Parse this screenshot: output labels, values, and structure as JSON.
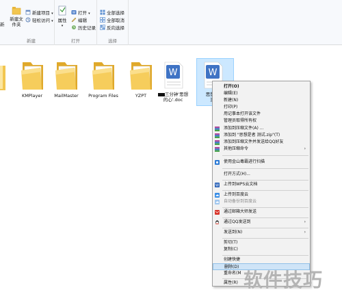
{
  "ribbon": {
    "new_group": {
      "label": "新建",
      "new_folder": "新建文件夹",
      "new_item": "新建项目",
      "easy_access": "轻松访问"
    },
    "open_group": {
      "label": "打开",
      "properties": "属性",
      "open": "打开",
      "edit": "编辑",
      "history": "历史记录"
    },
    "select_group": {
      "label": "选择",
      "select_all": "全部选择",
      "select_none": "全部取消",
      "invert": "反向选择"
    },
    "partial_left": "新"
  },
  "files": [
    {
      "name": "KMPlayer"
    },
    {
      "name": "MailMaster"
    },
    {
      "name": "Program Files"
    },
    {
      "name": "YZPT"
    },
    {
      "name_line1": "三分钟'思想",
      "name_line2": "的心'.doc"
    },
    {
      "name_line1": "思想是",
      "name_line2": "测"
    }
  ],
  "menu": {
    "items": [
      {
        "label": "打开(O)"
      },
      {
        "label": "编辑(E)"
      },
      {
        "label": "新建(N)"
      },
      {
        "label": "打印(P)"
      },
      {
        "label": "用记事本打开该文件"
      },
      {
        "label": "管理员取得所有权"
      },
      {
        "label": "添加到压缩文件(A) ..."
      },
      {
        "label": "添加到 \"思想是者 测试.zip\"(T)"
      },
      {
        "label": "添加到压缩文件并发送给QQ好友"
      },
      {
        "label": "其他压缩命令"
      },
      {
        "label": "使用金山毒霸进行扫描"
      },
      {
        "label": "打开方式(H)..."
      },
      {
        "label": "上传到WPS云文档"
      },
      {
        "label": "上传到百度云"
      },
      {
        "label": "自动备份到百度云"
      },
      {
        "label": "通过邮箱大师发送"
      },
      {
        "label": "通过QQ发送到"
      },
      {
        "label": "发送到(N)"
      },
      {
        "label": "剪切(T)"
      },
      {
        "label": "复制(C)"
      },
      {
        "label": "创建快捷"
      },
      {
        "label": "删除(D)"
      },
      {
        "label": "重命名(M"
      },
      {
        "label": "属性(R)"
      }
    ]
  },
  "watermark": "软件技巧",
  "colors": {
    "folder": "#f2c650",
    "folder_dark": "#e0a92b",
    "wps_blue": "#3f73c4",
    "selection": "#cce8ff",
    "menu_highlight": "#cfe4f7"
  }
}
